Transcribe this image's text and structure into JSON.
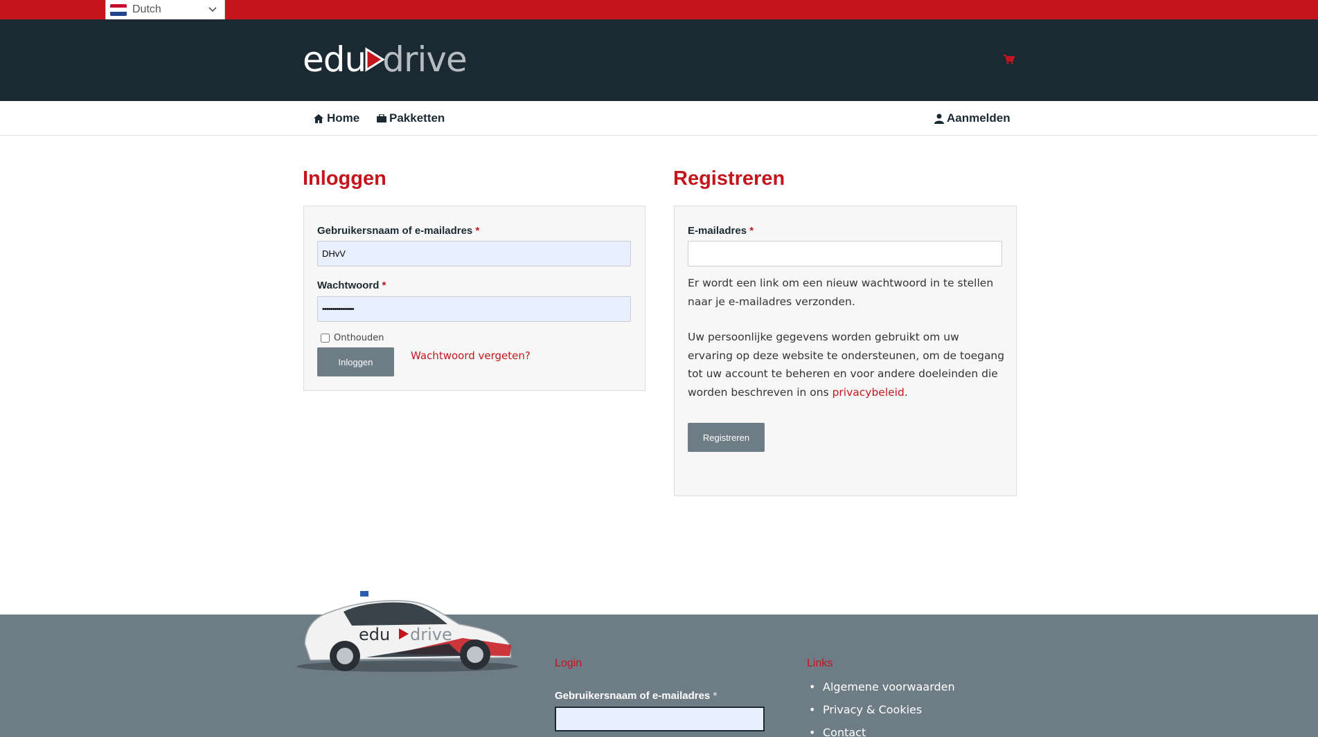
{
  "language": {
    "selected": "Dutch"
  },
  "brand": {
    "edu": "edu",
    "drive": "drive",
    "accent": "#c4151c",
    "dark": "#1b2a32"
  },
  "nav": {
    "home": "Home",
    "packages": "Pakketten",
    "login": "Aanmelden"
  },
  "login": {
    "title": "Inloggen",
    "username_label": "Gebruikersnaam of e-mailadres",
    "username_value": "DHvV",
    "password_label": "Wachtwoord",
    "password_value": "••••••••••••••••",
    "required_mark": "*",
    "remember_label": "Onthouden",
    "submit_label": "Inloggen",
    "forgot_label": "Wachtwoord vergeten?"
  },
  "register": {
    "title": "Registreren",
    "email_label": "E-mailadres",
    "required_mark": "*",
    "info_text": "Er wordt een link om een nieuw wachtwoord in te stellen naar je e-mailadres verzonden.",
    "privacy_text_before": "Uw persoonlijke gegevens worden gebruikt om uw ervaring op deze website te ondersteunen, om de toegang tot uw account te beheren en voor andere doeleinden die worden beschreven in ons ",
    "privacy_link": "privacybeleid",
    "privacy_text_after": ".",
    "submit_label": "Registreren"
  },
  "footer": {
    "login_heading": "Login",
    "username_label": "Gebruikersnaam of e-mailadres",
    "required_mark": "*",
    "links_heading": "Links",
    "links": [
      "Algemene voorwaarden",
      "Privacy & Cookies",
      "Contact"
    ]
  }
}
